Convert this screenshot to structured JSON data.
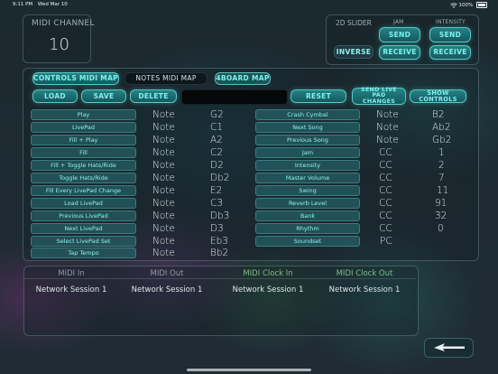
{
  "status_bar": {
    "time": "9:11 PM",
    "date": "Wed Mar 10",
    "battery": "100%"
  },
  "midi_channel": {
    "label": "MIDI CHANNEL",
    "value": "10"
  },
  "slider_2d": {
    "label": "2D SLIDER",
    "jam_label": "JAM",
    "intensity_label": "INTENSITY",
    "jam_send": "SEND",
    "intensity_send": "SEND",
    "inverse": "INVERSE",
    "jam_receive": "RECEIVE",
    "intensity_receive": "RECEIVE"
  },
  "tabs": {
    "controls": "CONTROLS MIDI MAP",
    "notes": "NOTES MIDI MAP",
    "board": "4BOARD MAP"
  },
  "toolbar": {
    "load": "LOAD",
    "save": "SAVE",
    "delete": "DELETE",
    "name_value": "",
    "reset": "RESET",
    "send_live": "SEND LIVE PAD CHANGES",
    "show_controls": "SHOW CONTROLS"
  },
  "left_map": [
    {
      "label": "Play",
      "type": "Note",
      "value": "G2"
    },
    {
      "label": "LivePad",
      "type": "Note",
      "value": "C1"
    },
    {
      "label": "Fill + Play",
      "type": "Note",
      "value": "A2"
    },
    {
      "label": "Fill",
      "type": "Note",
      "value": "C2"
    },
    {
      "label": "Fill + Toggle Hats/Ride",
      "type": "Note",
      "value": "D2"
    },
    {
      "label": "Toggle Hats/Ride",
      "type": "Note",
      "value": "Db2"
    },
    {
      "label": "Fill Every LivePad Change",
      "type": "Note",
      "value": "E2"
    },
    {
      "label": "Load LivePad",
      "type": "Note",
      "value": "C3"
    },
    {
      "label": "Previous LivePad",
      "type": "Note",
      "value": "Db3"
    },
    {
      "label": "Next LivePad",
      "type": "Note",
      "value": "D3"
    },
    {
      "label": "Select LivePad Set",
      "type": "Note",
      "value": "Eb3"
    },
    {
      "label": "Tap Tempo",
      "type": "Note",
      "value": "Bb2"
    }
  ],
  "right_map": [
    {
      "label": "Crash Cymbal",
      "type": "Note",
      "value": "B2"
    },
    {
      "label": "Next Song",
      "type": "Note",
      "value": "Ab2"
    },
    {
      "label": "Previous Song",
      "type": "Note",
      "value": "Gb2"
    },
    {
      "label": "Jam",
      "type": "CC",
      "value": "1"
    },
    {
      "label": "Intensity",
      "type": "CC",
      "value": "2"
    },
    {
      "label": "Master Volume",
      "type": "CC",
      "value": "7"
    },
    {
      "label": "Swing",
      "type": "CC",
      "value": "11"
    },
    {
      "label": "Reverb Level",
      "type": "CC",
      "value": "91"
    },
    {
      "label": "Bank",
      "type": "CC",
      "value": "32"
    },
    {
      "label": "Rhythm",
      "type": "CC",
      "value": "0"
    },
    {
      "label": "Soundset",
      "type": "PC",
      "value": ""
    }
  ],
  "sessions": {
    "midi_in": {
      "label": "MIDI In",
      "value": "Network Session 1"
    },
    "midi_out": {
      "label": "MIDI Out",
      "value": "Network Session 1"
    },
    "clock_in": {
      "label": "MIDI Clock In",
      "value": "Network Session 1"
    },
    "clock_out": {
      "label": "MIDI Clock Out",
      "value": "Network Session 1"
    }
  },
  "back_button": {
    "icon": "back-arrow-icon"
  }
}
